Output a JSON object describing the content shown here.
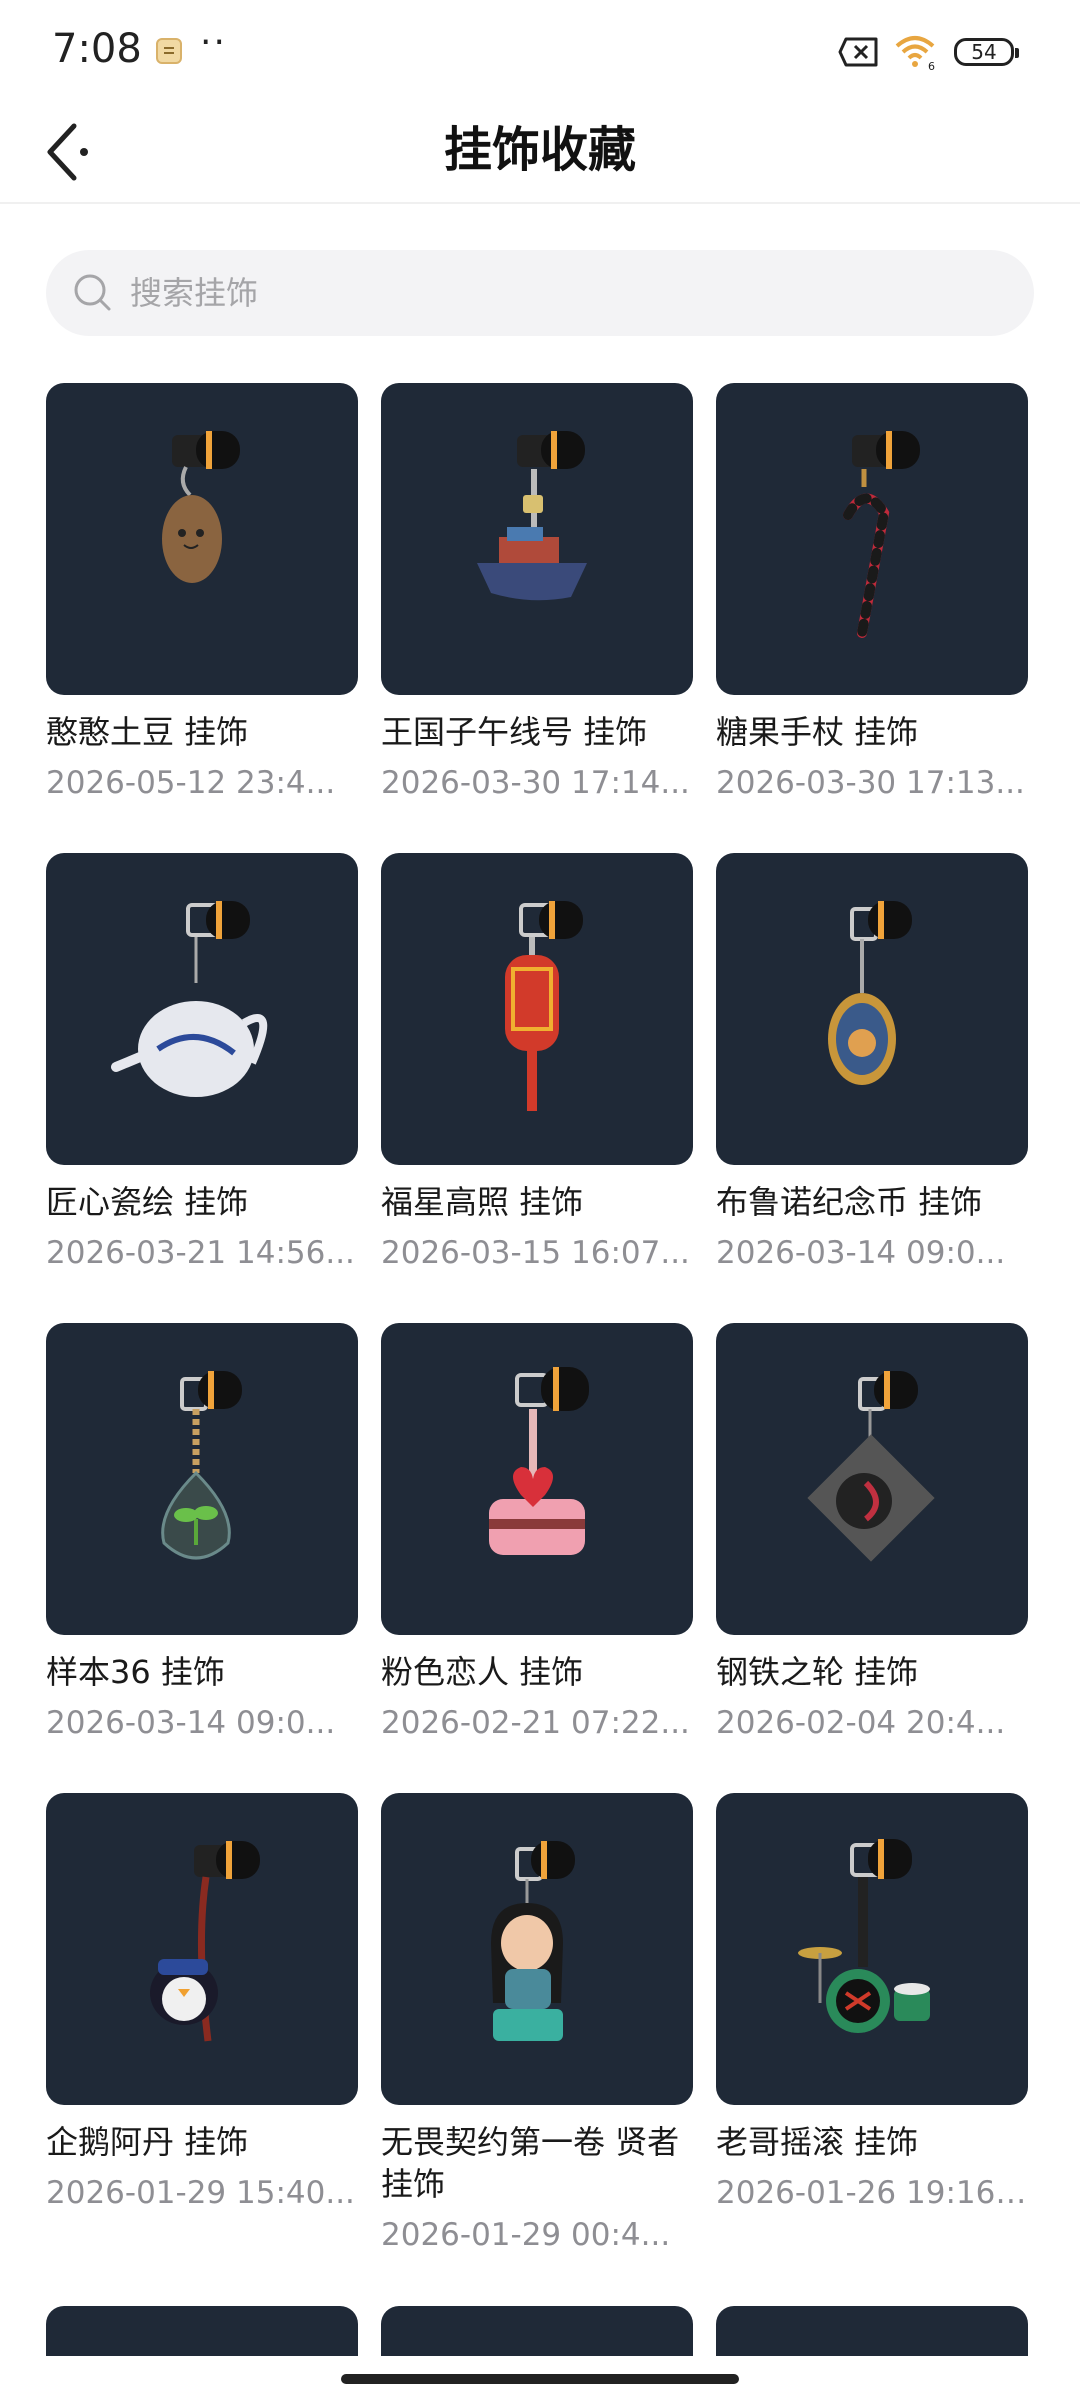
{
  "status_bar": {
    "time": "7:08",
    "dots": "··",
    "battery": "54",
    "wifi_badge": "6",
    "icons": [
      "notification-icon",
      "sim-blocked-icon",
      "wifi-icon",
      "battery-icon"
    ]
  },
  "nav": {
    "title": "挂饰收藏",
    "back_icon": "chevron-left-icon"
  },
  "search": {
    "placeholder": "搜索挂饰",
    "value": "",
    "icon": "search-icon"
  },
  "colors": {
    "thumb_background": "#1f2937",
    "date_text": "#8e8e93"
  },
  "items": [
    {
      "name": "憨憨土豆 挂饰",
      "date": "2026-05-12 23:4...",
      "charm": "potato"
    },
    {
      "name": "王国子午线号 挂饰",
      "date": "2026-03-30 17:14...",
      "charm": "ship"
    },
    {
      "name": "糖果手杖 挂饰",
      "date": "2026-03-30 17:13...",
      "charm": "candy-cane"
    },
    {
      "name": "匠心瓷绘 挂饰",
      "date": "2026-03-21 14:56...",
      "charm": "teapot"
    },
    {
      "name": "福星高照 挂饰",
      "date": "2026-03-15 16:07...",
      "charm": "lantern"
    },
    {
      "name": "布鲁诺纪念币 挂饰",
      "date": "2026-03-14 09:0...",
      "charm": "coin-medallion"
    },
    {
      "name": "样本36 挂饰",
      "date": "2026-03-14 09:0...",
      "charm": "seedling-flask"
    },
    {
      "name": "粉色恋人 挂饰",
      "date": "2026-02-21 07:22...",
      "charm": "heart-cake"
    },
    {
      "name": "钢铁之轮 挂饰",
      "date": "2026-02-04 20:4...",
      "charm": "turntable"
    },
    {
      "name": "企鹅阿丹 挂饰",
      "date": "2026-01-29 15:40...",
      "charm": "penguin"
    },
    {
      "name": "无畏契约第一卷 贤者 挂饰",
      "date": "2026-01-29 00:4...",
      "charm": "sage-figure"
    },
    {
      "name": "老哥摇滚 挂饰",
      "date": "2026-01-26 19:16:...",
      "charm": "drum-kit"
    }
  ]
}
